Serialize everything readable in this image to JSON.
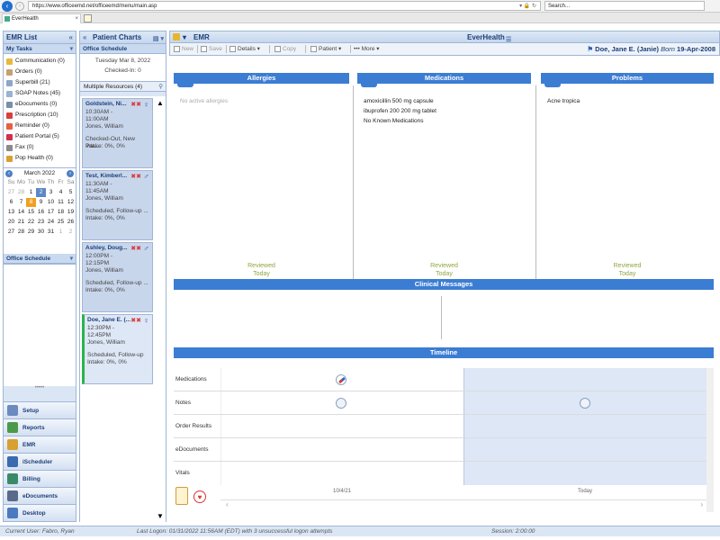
{
  "browser": {
    "url": "https://www.officeemd.net/officeemd/menu/main.asp",
    "search_placeholder": "Search...",
    "tab_title": "EverHealth"
  },
  "app": {
    "emr_list_title": "EMR List",
    "my_tasks_title": "My Tasks",
    "tasks": [
      {
        "label": "Communication (0)",
        "icon": "envelope-icon",
        "color": "#e8b840"
      },
      {
        "label": "Orders (0)",
        "icon": "clipboard-icon",
        "color": "#c7a070"
      },
      {
        "label": "Superbill (21)",
        "icon": "document-icon",
        "color": "#8fa6c8"
      },
      {
        "label": "SOAP Notes (45)",
        "icon": "notes-icon",
        "color": "#9bb2d4"
      },
      {
        "label": "eDocuments (0)",
        "icon": "edocuments-icon",
        "color": "#7a8ea8"
      },
      {
        "label": "Prescription (10)",
        "icon": "pill-icon",
        "color": "#d84040",
        "badge": true
      },
      {
        "label": "Reminder (0)",
        "icon": "reminder-icon",
        "color": "#e86040"
      },
      {
        "label": "Patient Portal (5)",
        "icon": "heart-icon",
        "color": "#d03050"
      },
      {
        "label": "Fax (0)",
        "icon": "fax-icon",
        "color": "#8a8a8a"
      },
      {
        "label": "Pop Health (0)",
        "icon": "pophealth-icon",
        "color": "#d8a030"
      }
    ],
    "calendar": {
      "month": "March 2022",
      "dow": [
        "Su",
        "Mo",
        "Tu",
        "We",
        "Th",
        "Fr",
        "Sa"
      ],
      "days": [
        [
          "27",
          "28",
          "1",
          "2",
          "3",
          "4",
          "5"
        ],
        [
          "6",
          "7",
          "8",
          "9",
          "10",
          "11",
          "12"
        ],
        [
          "13",
          "14",
          "15",
          "16",
          "17",
          "18",
          "19"
        ],
        [
          "20",
          "21",
          "22",
          "23",
          "24",
          "25",
          "26"
        ],
        [
          "27",
          "28",
          "29",
          "30",
          "31",
          "1",
          "2"
        ]
      ]
    },
    "office_schedule_label": "Office Schedule",
    "nav": [
      {
        "label": "Setup",
        "icon": "setup-icon",
        "color": "#6a8ac0"
      },
      {
        "label": "Reports",
        "icon": "reports-icon",
        "color": "#4a9a4a"
      },
      {
        "label": "EMR",
        "icon": "emr-icon",
        "color": "#d8a030"
      },
      {
        "label": "iScheduler",
        "icon": "scheduler-icon",
        "color": "#3a6ab0"
      },
      {
        "label": "Billing",
        "icon": "billing-icon",
        "color": "#3a8a6a"
      },
      {
        "label": "eDocuments",
        "icon": "edocuments-icon",
        "color": "#5a6a8a"
      },
      {
        "label": "Desktop",
        "icon": "desktop-icon",
        "color": "#4a7ac0"
      }
    ]
  },
  "patient_charts": {
    "title": "Patient Charts",
    "office_schedule": "Office Schedule",
    "date": "Tuesday Mar 8, 2022",
    "checked_in": "Checked-In: 0",
    "resources": "Multiple Resources (4)",
    "appointments": [
      {
        "name": "Goldstein, Ni...",
        "start": "10:30AM -",
        "end": "11:00AM",
        "provider": "Jones, William",
        "status": "Checked-Out, New Pat...",
        "intake": "Intake: 0%, 0%",
        "flags": "✖✖",
        "gender": "♀",
        "active": false
      },
      {
        "name": "Test, Kimberl...",
        "start": "11:30AM -",
        "end": "11:45AM",
        "provider": "Jones, William",
        "status": "Scheduled, Follow-up ...",
        "intake": "Intake: 0%, 0%",
        "flags": "✖✖",
        "gender": "♂",
        "active": false
      },
      {
        "name": "Ashley, Doug...",
        "start": "12:00PM -",
        "end": "12:15PM",
        "provider": "Jones, William",
        "status": "Scheduled, Follow-up ...",
        "intake": "Intake: 0%, 0%",
        "flags": "✖✖",
        "gender": "♂",
        "active": false
      },
      {
        "name": "Doe, Jane E. (...",
        "start": "12:30PM -",
        "end": "12:45PM",
        "provider": "Jones, William",
        "status": "Scheduled, Follow-up ...",
        "intake": "Intake: 0%, 0%",
        "flags": "✖✖",
        "gender": "♀",
        "active": true
      }
    ]
  },
  "emr": {
    "title": "EMR",
    "center_title": "EverHealth",
    "toolbar": {
      "new": "New",
      "save": "Save",
      "details": "Details",
      "copy": "Copy",
      "patient": "Patient",
      "more": "More"
    },
    "patient_label": "Doe, Jane E. (Janie)",
    "born_label": "Born",
    "born_date": "19-Apr-2008",
    "allergies": {
      "title": "Allergies",
      "items": [
        "No active allergies"
      ],
      "reviewed": "Reviewed",
      "when": "Today"
    },
    "medications": {
      "title": "Medications",
      "items": [
        "amoxicillin 500 mg capsule",
        "ibuprofen 200 200 mg tablet",
        "No Known Medications"
      ],
      "reviewed": "Reviewed",
      "when": "Today"
    },
    "problems": {
      "title": "Problems",
      "items": [
        "Acne tropica"
      ],
      "reviewed": "Reviewed",
      "when": "Today"
    },
    "clinical_messages": "Clinical Messages",
    "timeline": {
      "title": "Timeline",
      "rows": [
        "Medications",
        "Notes",
        "Order Results",
        "eDocuments",
        "Vitals"
      ],
      "dates": [
        "10/4/21",
        "Today"
      ]
    }
  },
  "status": {
    "user": "Current User: Fabro, Ryan",
    "last_logon": "Last Logon: 01/31/2022 11:56AM (EDT) with 3 unsuccessful logon attempts",
    "session": "Session: 2:00:00"
  }
}
